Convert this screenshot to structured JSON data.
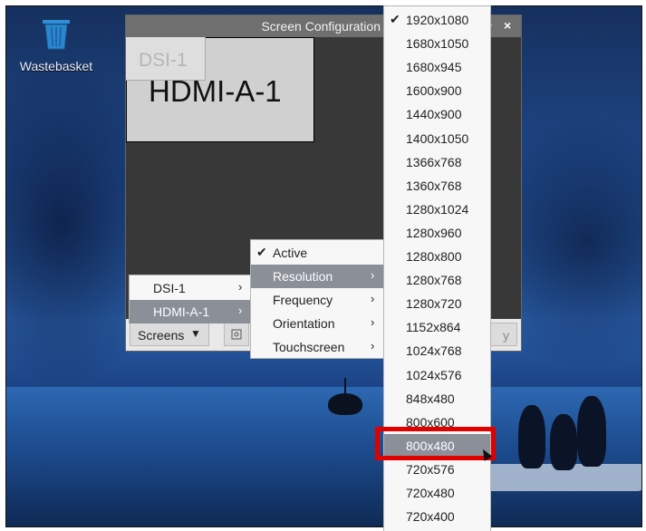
{
  "desktop": {
    "icons": [
      {
        "label": "Wastebasket",
        "icon": "trash-bin-icon"
      }
    ]
  },
  "window": {
    "title": "Screen Configuration",
    "title_buttons": {
      "minimize": "^",
      "close": "×"
    },
    "screens": {
      "dsi": "DSI-1",
      "hdmi": "HDMI-A-1"
    },
    "bottom_bar": {
      "screens_button": "Screens",
      "screens_arrow": "▼",
      "apply_button_partial": "y"
    }
  },
  "screens_menu": {
    "items": [
      {
        "label": "DSI-1",
        "submenu": "›"
      },
      {
        "label": "HDMI-A-1",
        "submenu": "›"
      }
    ]
  },
  "properties_menu": {
    "items": [
      {
        "label": "Active",
        "check": "✔"
      },
      {
        "label": "Resolution",
        "submenu": "›"
      },
      {
        "label": "Frequency",
        "submenu": "›"
      },
      {
        "label": "Orientation",
        "submenu": "›"
      },
      {
        "label": "Touchscreen",
        "submenu": "›"
      }
    ]
  },
  "resolution_menu": {
    "checked_mark": "✔",
    "items": [
      "1920x1080",
      "1680x1050",
      "1680x945",
      "1600x900",
      "1440x900",
      "1400x1050",
      "1366x768",
      "1360x768",
      "1280x1024",
      "1280x960",
      "1280x800",
      "1280x768",
      "1280x720",
      "1152x864",
      "1024x768",
      "1024x576",
      "848x480",
      "800x600",
      "800x480",
      "720x576",
      "720x480",
      "720x400"
    ],
    "selected": "1920x1080",
    "hovered": "800x480"
  },
  "colors": {
    "highlight_box": "#e00000",
    "menu_hover": "#8a8f98",
    "titlebar": "#6f6f6f"
  }
}
